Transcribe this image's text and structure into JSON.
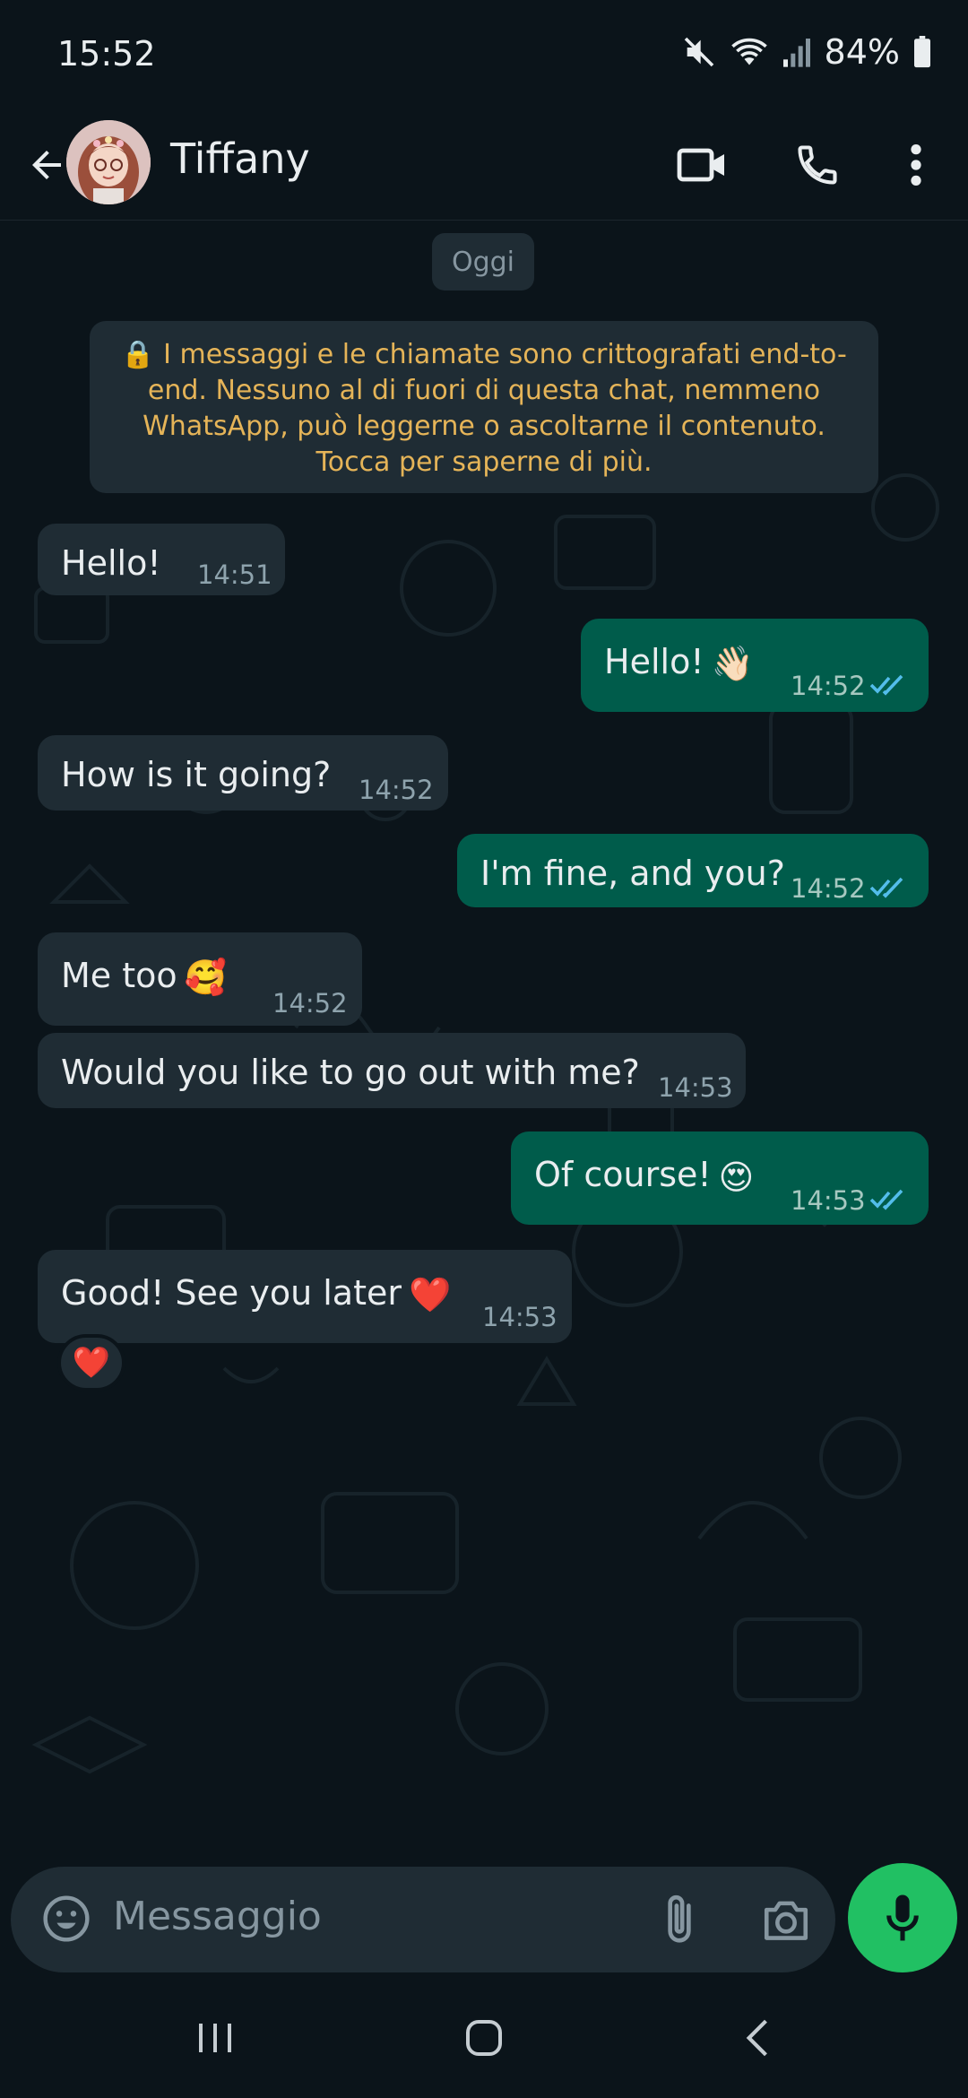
{
  "status_bar": {
    "time": "15:52",
    "battery": "84%",
    "icons": [
      "mute-icon",
      "wifi-icon",
      "signal-icon",
      "battery-icon"
    ]
  },
  "header": {
    "contact_name": "Tiffany",
    "icons": [
      "back-arrow-icon",
      "avatar",
      "video-call-icon",
      "phone-icon",
      "more-vert-icon"
    ]
  },
  "chat": {
    "date_chip": "Oggi",
    "encryption_notice": "🔒 I messaggi e le chiamate sono crittografati end-to-end. Nessuno al di fuori di questa chat, nemmeno WhatsApp, può leggerne o ascoltarne il contenuto. Tocca per saperne di più.",
    "messages": [
      {
        "direction": "in",
        "text": "Hello!",
        "time": "14:51"
      },
      {
        "direction": "out",
        "text": "Hello!",
        "emoji": "👋🏻",
        "time": "14:52",
        "status": "read"
      },
      {
        "direction": "in",
        "text": "How is it going?",
        "time": "14:52"
      },
      {
        "direction": "out",
        "text": "I'm fine, and you?",
        "time": "14:52",
        "status": "read"
      },
      {
        "direction": "in",
        "text": "Me too",
        "emoji": "🥰",
        "time": "14:52"
      },
      {
        "direction": "in",
        "text": "Would you like to go out with me?",
        "time": "14:53"
      },
      {
        "direction": "out",
        "text": "Of course!",
        "emoji": "😍",
        "time": "14:53",
        "status": "read"
      },
      {
        "direction": "in",
        "text": "Good! See you later",
        "emoji": "❤️",
        "time": "14:53",
        "reaction": "❤️"
      }
    ]
  },
  "input": {
    "placeholder": "Messaggio",
    "icons": [
      "emoji-icon",
      "attach-icon",
      "camera-icon",
      "mic-icon"
    ]
  },
  "nav": {
    "icons": [
      "recents-icon",
      "home-icon",
      "back-icon"
    ]
  },
  "colors": {
    "background": "#0b141a",
    "incoming_bubble": "#1f2c34",
    "outgoing_bubble": "#005c4b",
    "accent_green": "#21c063",
    "encryption_text": "#e5b458",
    "read_tick": "#53bdeb"
  }
}
